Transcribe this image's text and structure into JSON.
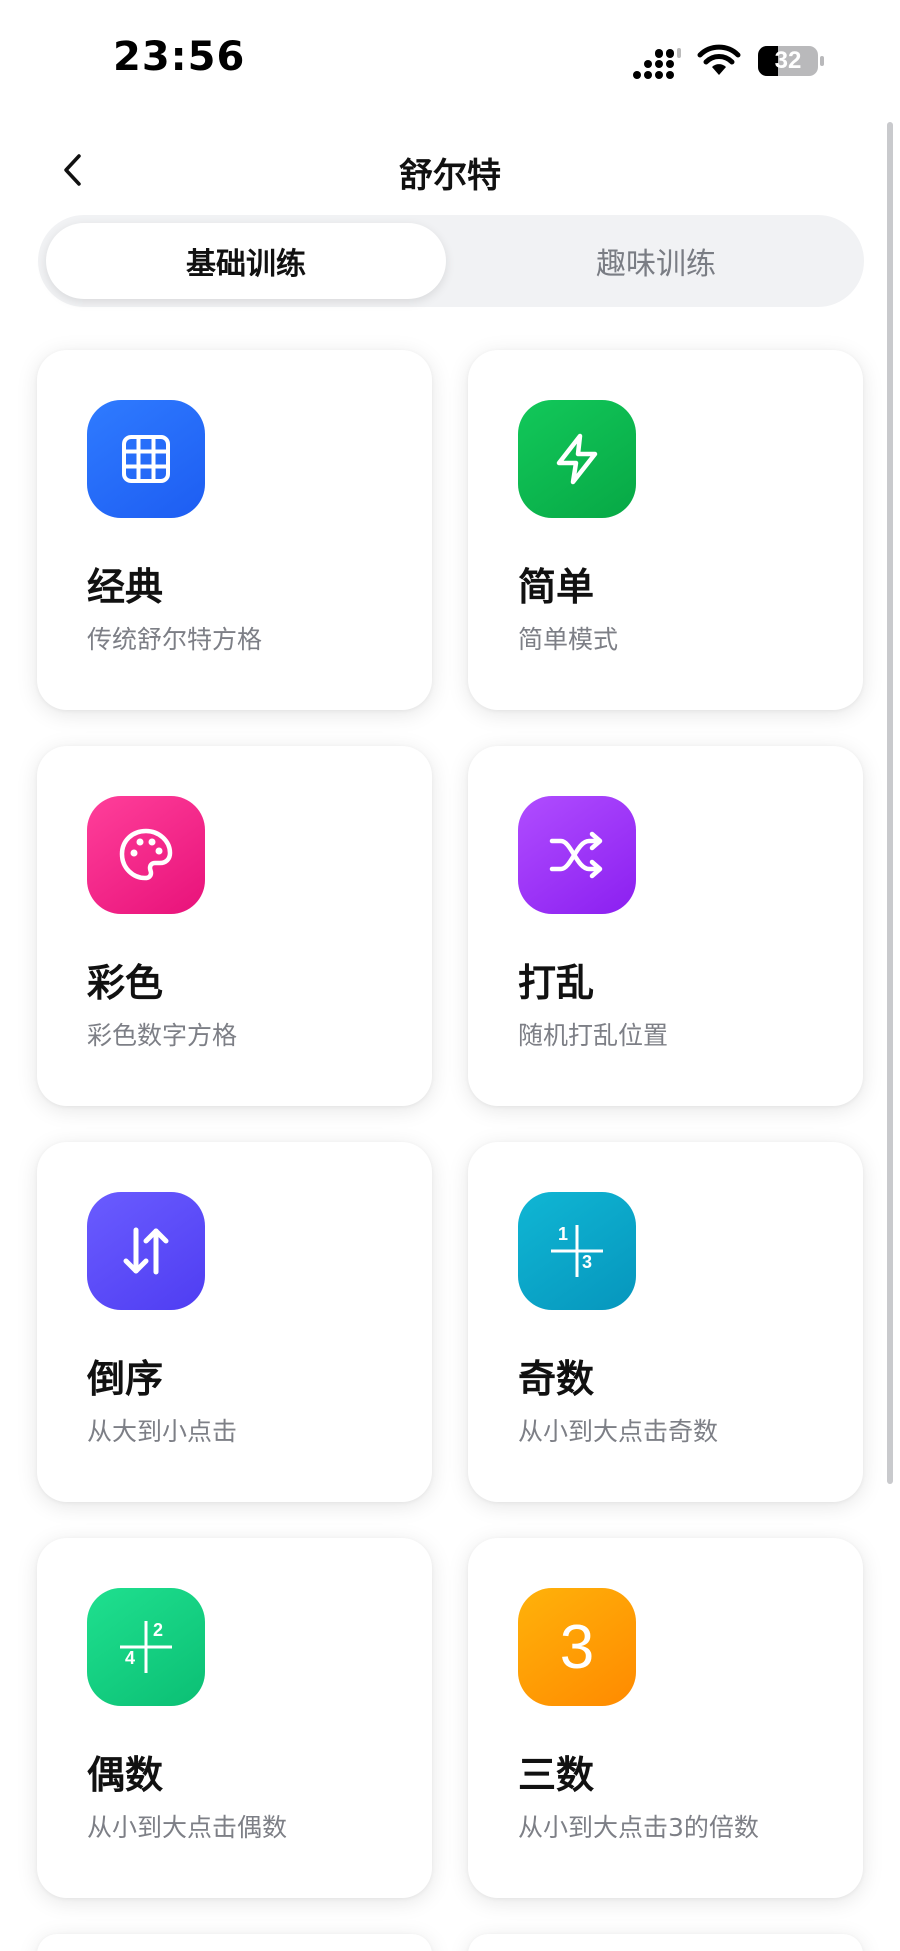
{
  "status": {
    "time": "23:56",
    "battery": "32"
  },
  "header": {
    "title": "舒尔特"
  },
  "tabs": [
    {
      "label": "基础训练",
      "selected": true
    },
    {
      "label": "趣味训练",
      "selected": false
    }
  ],
  "cards": [
    {
      "title": "经典",
      "subtitle": "传统舒尔特方格",
      "icon": "grid-icon",
      "color": "#2f7bff"
    },
    {
      "title": "简单",
      "subtitle": "简单模式",
      "icon": "lightning-icon",
      "color": "#12c85a"
    },
    {
      "title": "彩色",
      "subtitle": "彩色数字方格",
      "icon": "palette-icon",
      "color": "#ff3f9a"
    },
    {
      "title": "打乱",
      "subtitle": "随机打乱位置",
      "icon": "shuffle-icon",
      "color": "#b04dff"
    },
    {
      "title": "倒序",
      "subtitle": "从大到小点击",
      "icon": "sort-arrows-icon",
      "color": "#6a5cff"
    },
    {
      "title": "奇数",
      "subtitle": "从小到大点击奇数",
      "icon": "odd-numbers-icon",
      "color": "#10b6d4",
      "icon_digits": [
        "1",
        "3"
      ]
    },
    {
      "title": "偶数",
      "subtitle": "从小到大点击偶数",
      "icon": "even-numbers-icon",
      "color": "#1fe08f",
      "icon_digits": [
        "2",
        "4"
      ]
    },
    {
      "title": "三数",
      "subtitle": "从小到大点击3的倍数",
      "icon": "three-icon",
      "color": "#ffb20a",
      "icon_digits": [
        "3"
      ]
    }
  ]
}
